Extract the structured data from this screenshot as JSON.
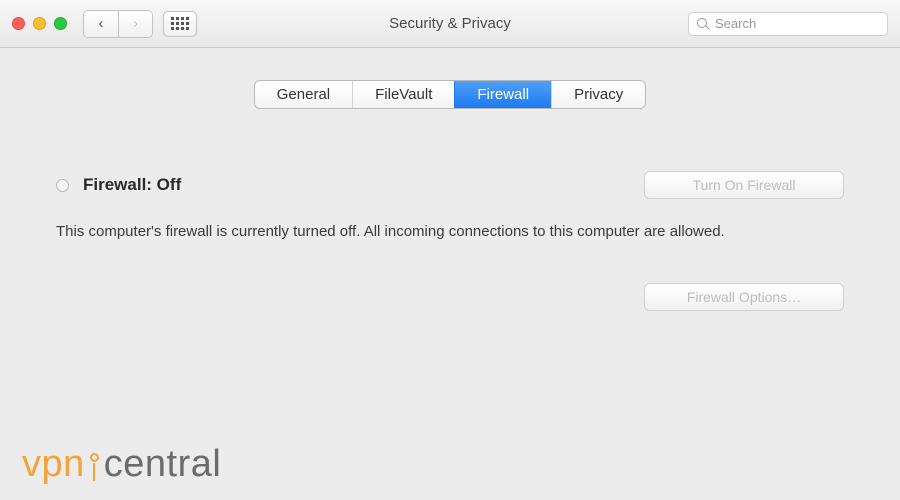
{
  "window": {
    "title": "Security & Privacy"
  },
  "toolbar": {
    "search_placeholder": "Search"
  },
  "tabs": {
    "items": [
      {
        "label": "General",
        "active": false
      },
      {
        "label": "FileVault",
        "active": false
      },
      {
        "label": "Firewall",
        "active": true
      },
      {
        "label": "Privacy",
        "active": false
      }
    ]
  },
  "firewall": {
    "status_label": "Firewall: Off",
    "status_indicator": "off",
    "turn_on_label": "Turn On Firewall",
    "description": "This computer's firewall is currently turned off. All incoming connections to this computer are allowed.",
    "options_label": "Firewall Options…"
  },
  "watermark": {
    "left": "vpn",
    "right": "central"
  }
}
